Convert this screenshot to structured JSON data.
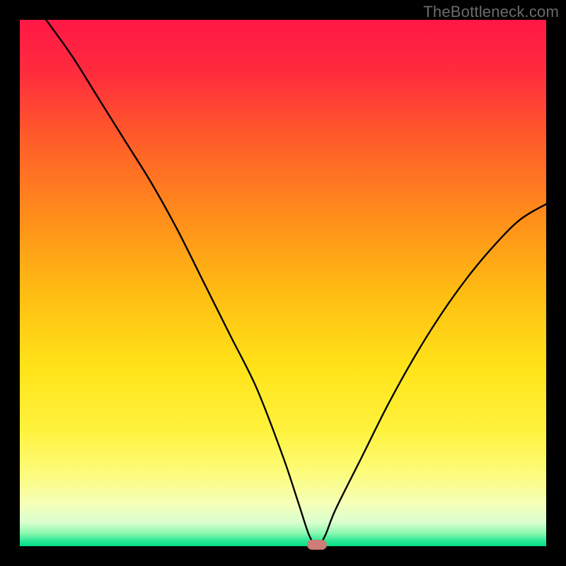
{
  "watermark": "TheBottleneck.com",
  "chart_data": {
    "type": "line",
    "title": "",
    "xlabel": "",
    "ylabel": "",
    "xlim": [
      0,
      100
    ],
    "ylim": [
      0,
      100
    ],
    "grid": false,
    "legend": false,
    "gradient_stops": [
      {
        "offset": 0.0,
        "color": "#ff1846"
      },
      {
        "offset": 0.1,
        "color": "#ff2c3d"
      },
      {
        "offset": 0.22,
        "color": "#ff5a2a"
      },
      {
        "offset": 0.38,
        "color": "#ff8f1a"
      },
      {
        "offset": 0.52,
        "color": "#ffbd12"
      },
      {
        "offset": 0.66,
        "color": "#ffe319"
      },
      {
        "offset": 0.78,
        "color": "#fff23d"
      },
      {
        "offset": 0.86,
        "color": "#fdfc7a"
      },
      {
        "offset": 0.92,
        "color": "#f5ffb8"
      },
      {
        "offset": 0.955,
        "color": "#d9ffcf"
      },
      {
        "offset": 0.975,
        "color": "#8ef8b0"
      },
      {
        "offset": 0.99,
        "color": "#2ae895"
      },
      {
        "offset": 1.0,
        "color": "#04df86"
      }
    ],
    "series": [
      {
        "name": "bottleneck-curve",
        "color": "#000000",
        "x": [
          5,
          10,
          15,
          20,
          25,
          30,
          35,
          40,
          45,
          50,
          53,
          55,
          56.5,
          58,
          60,
          65,
          70,
          75,
          80,
          85,
          90,
          95,
          100
        ],
        "y": [
          100,
          93,
          85,
          77,
          69,
          60,
          50,
          40,
          30,
          17,
          8,
          2,
          0,
          2,
          7,
          17,
          27,
          36,
          44,
          51,
          57,
          62,
          65
        ]
      }
    ],
    "marker": {
      "x": 56.5,
      "y": 0,
      "color": "#cc7d77"
    }
  }
}
